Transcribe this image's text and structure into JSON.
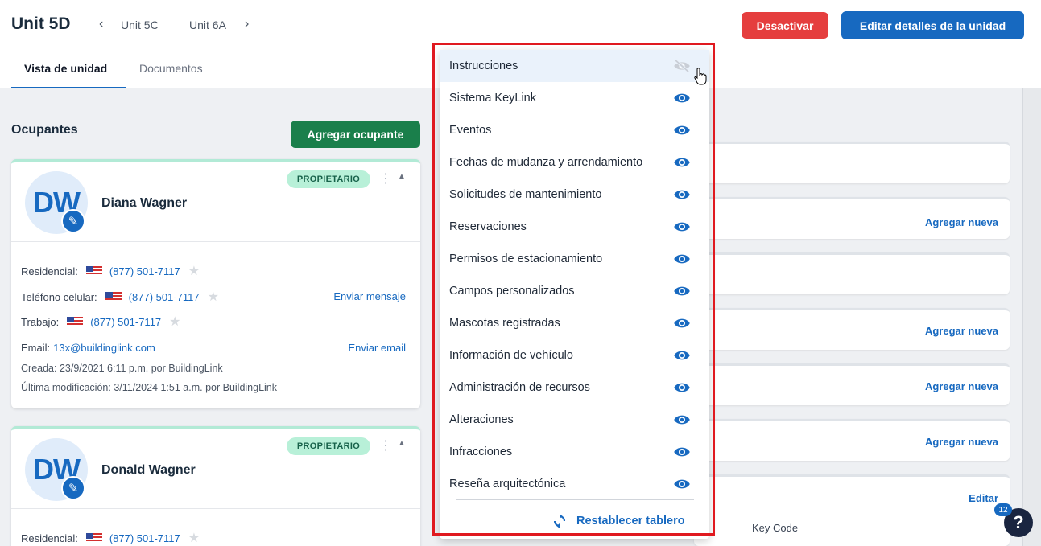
{
  "header": {
    "unit_title": "Unit 5D",
    "prev_unit": "Unit 5C",
    "next_unit": "Unit 6A",
    "deactivate_label": "Desactivar",
    "edit_label": "Editar detalles de la unidad"
  },
  "tabs": [
    {
      "label": "Vista de unidad",
      "active": true
    },
    {
      "label": "Documentos",
      "active": false
    }
  ],
  "occupants": {
    "title": "Ocupantes",
    "add_label": "Agregar ocupante",
    "list": [
      {
        "initials": "DW",
        "name": "Diana Wagner",
        "badge": "PROPIETARIO",
        "residential_label": "Residencial:",
        "residential_phone": "(877) 501-7117",
        "mobile_label": "Teléfono celular:",
        "mobile_phone": "(877) 501-7117",
        "send_message": "Enviar mensaje",
        "work_label": "Trabajo:",
        "work_phone": "(877) 501-7117",
        "email_label": "Email:",
        "email": "13x@buildinglink.com",
        "send_email": "Enviar email",
        "created_label": "Creada:",
        "created": "23/9/2021 6:11 p.m. por BuildingLink",
        "modified_label": "Última modificación:",
        "modified": "3/11/2024 1:51 a.m. por BuildingLink"
      },
      {
        "initials": "DW",
        "name": "Donald Wagner",
        "badge": "PROPIETARIO",
        "residential_label": "Residencial:",
        "residential_phone": "(877) 501-7117"
      }
    ]
  },
  "panels": {
    "add_new": "Agregar nueva",
    "edit": "Editar",
    "key_code": "Key Code"
  },
  "menu": {
    "items": [
      {
        "label": "Instrucciones",
        "visible": false
      },
      {
        "label": "Sistema KeyLink",
        "visible": true
      },
      {
        "label": "Eventos",
        "visible": true
      },
      {
        "label": "Fechas de mudanza y arrendamiento",
        "visible": true
      },
      {
        "label": "Solicitudes de mantenimiento",
        "visible": true
      },
      {
        "label": "Reservaciones",
        "visible": true
      },
      {
        "label": "Permisos de estacionamiento",
        "visible": true
      },
      {
        "label": "Campos personalizados",
        "visible": true
      },
      {
        "label": "Mascotas registradas",
        "visible": true
      },
      {
        "label": "Información de vehículo",
        "visible": true
      },
      {
        "label": "Administración de recursos",
        "visible": true
      },
      {
        "label": "Alteraciones",
        "visible": true
      },
      {
        "label": "Infracciones",
        "visible": true
      },
      {
        "label": "Reseña arquitectónica",
        "visible": true
      }
    ],
    "reset_label": "Restablecer tablero"
  },
  "help": {
    "badge_count": "12",
    "label": "?"
  },
  "colors": {
    "primary": "#1769c0",
    "danger": "#e53e3e",
    "success": "#1a7f4b",
    "highlight": "#e0191f"
  }
}
